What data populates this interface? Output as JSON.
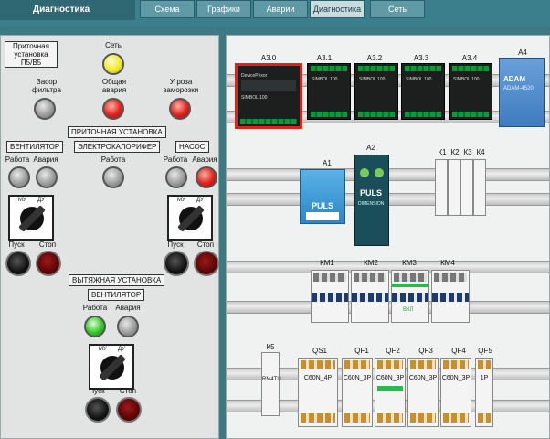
{
  "app_title": "Диагностика",
  "tabs": [
    {
      "label": "Схема"
    },
    {
      "label": "Графики"
    },
    {
      "label": "Аварии"
    },
    {
      "label": "Диагностика"
    },
    {
      "label": "Сеть"
    }
  ],
  "left": {
    "unit_title": "Приточная установка П5/В5",
    "network": "Сеть",
    "filter": "Засор фильтра",
    "general_alarm": "Общая авария",
    "freeze": "Угроза заморозки",
    "supply_unit": "ПРИТОЧНАЯ УСТАНОВКА",
    "fan": "ВЕНТИЛЯТОР",
    "heater": "ЭЛЕКТРОКАЛОРИФЕР",
    "pump": "НАСОС",
    "run": "Работа",
    "alarm": "Авария",
    "start": "Пуск",
    "stop": "Стоп",
    "mu": "МУ",
    "du": "ДУ",
    "exhaust_unit": "ВЫТЯЖНАЯ УСТАНОВКА",
    "exhaust_fan": "ВЕНТИЛЯТОР"
  },
  "right": {
    "modules": [
      "А3.0",
      "А3.1",
      "А3.2",
      "А3.3",
      "А3.4",
      "А4"
    ],
    "a1": "А1",
    "a2": "А2",
    "brand_line1": "DevicePrixor",
    "brand_line2": "SIMBOL 100",
    "brand_small": "SIMBOL 100",
    "adam_name": "ADAM",
    "adam_model": "ADAM-4520",
    "puls_a1": "PULS",
    "puls_a2": "PULS",
    "puls_a2_sub": "DIMENSION",
    "k_labels": [
      "К1",
      "К2",
      "К3",
      "К4"
    ],
    "km_labels": [
      "КМ1",
      "КМ2",
      "КМ3",
      "КМ4"
    ],
    "vkl": "ВКЛ",
    "k5": "К5",
    "k5_sub": "RM4TU",
    "qs1": "QS1",
    "qs1_val": "C60N_4P",
    "qf_labels": [
      "QF1",
      "QF2",
      "QF3",
      "QF4",
      "QF5"
    ],
    "qf_values": [
      "C60N_3P",
      "C60N_3P",
      "C60N_3P",
      "C60N_3P",
      "1P"
    ]
  },
  "colors": {
    "accent": "#3b7f8c",
    "panel": "#e2e4e4",
    "lamp_red": "#e0221b",
    "lamp_yellow": "#f1ea2c",
    "lamp_green": "#36c82a",
    "terminal": "#0a9a3a"
  }
}
